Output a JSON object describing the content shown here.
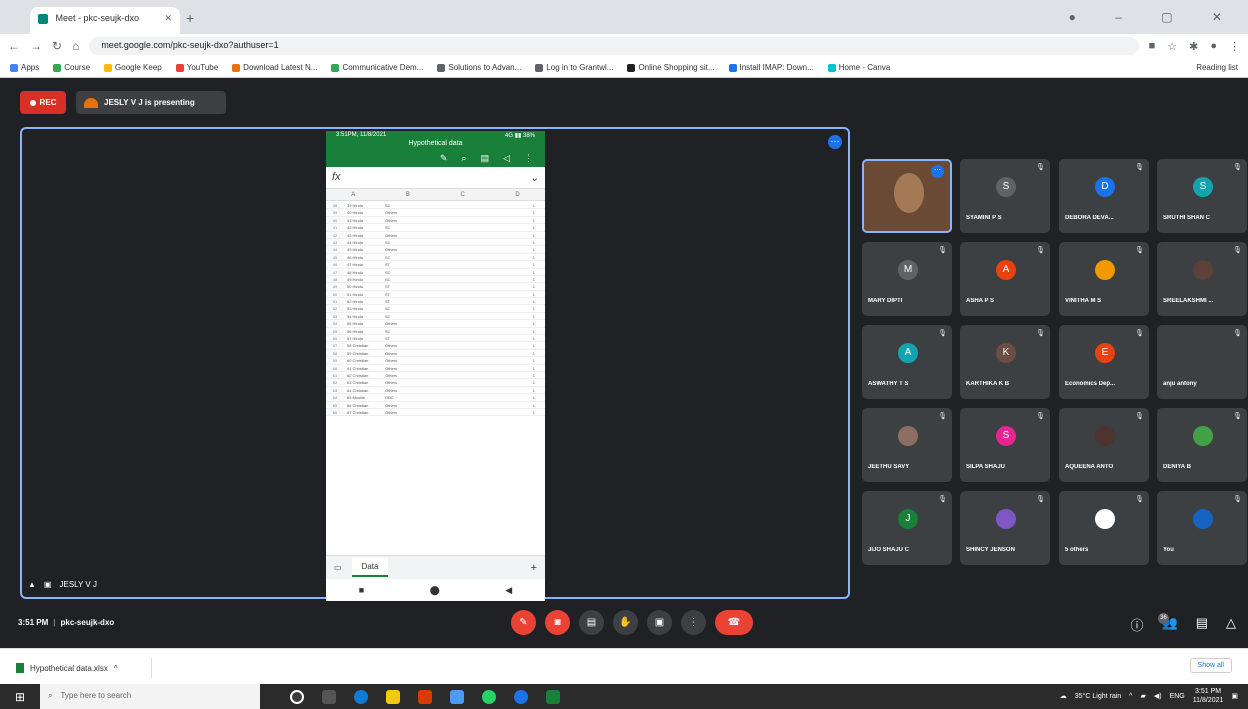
{
  "browser": {
    "tab_title": "Meet - pkc-seujk-dxo",
    "url": "meet.google.com/pkc-seujk-dxo?authuser=1",
    "bookmarks": [
      {
        "label": "Apps",
        "color": "#4285f4"
      },
      {
        "label": "Course",
        "color": "#34a853"
      },
      {
        "label": "Google Keep",
        "color": "#fbbc04"
      },
      {
        "label": "YouTube",
        "color": "#ea4335"
      },
      {
        "label": "Download Latest N...",
        "color": "#e8710a"
      },
      {
        "label": "Communicative Dem...",
        "color": "#34a853"
      },
      {
        "label": "Solutions to Advan...",
        "color": "#5f6368"
      },
      {
        "label": "Log in to Grantwl...",
        "color": "#5f6368"
      },
      {
        "label": "Online Shopping sit...",
        "color": "#202124"
      },
      {
        "label": "Install IMAP: Down...",
        "color": "#1a73e8"
      },
      {
        "label": "Home - Canva",
        "color": "#00c4cc"
      }
    ],
    "reading_list": "Reading list"
  },
  "meet": {
    "rec_label": "REC",
    "presenting_label": "JESLY V J is presenting",
    "presenter_tile_label": "JESLY V J",
    "meeting_time": "3:51 PM",
    "meeting_code": "pkc-seujk-dxo",
    "people_count": "36"
  },
  "phone": {
    "status_time": "3:51PM, 11/8/2021",
    "status_right": "4G ▮▮ 38%",
    "sheet_title": "Hypothetical data",
    "fx": "fx",
    "col_headers": [
      "A",
      "B",
      "C",
      "D"
    ],
    "rows": [
      {
        "n": "38",
        "a": "39 Hindu",
        "b": "SC",
        "c": "1"
      },
      {
        "n": "39",
        "a": "40 Hindu",
        "b": "Others",
        "c": "1"
      },
      {
        "n": "40",
        "a": "41 Hindu",
        "b": "Others",
        "c": "1"
      },
      {
        "n": "41",
        "a": "42 Hindu",
        "b": "SC",
        "c": "1"
      },
      {
        "n": "42",
        "a": "43 Hindu",
        "b": "Others",
        "c": "1"
      },
      {
        "n": "43",
        "a": "44 Hindu",
        "b": "SC",
        "c": "1"
      },
      {
        "n": "44",
        "a": "45 Hindu",
        "b": "Others",
        "c": "1"
      },
      {
        "n": "45",
        "a": "46 Hindu",
        "b": "SC",
        "c": "1"
      },
      {
        "n": "46",
        "a": "47 Hindu",
        "b": "ST",
        "c": "1"
      },
      {
        "n": "47",
        "a": "48 Hindu",
        "b": "SC",
        "c": "1"
      },
      {
        "n": "48",
        "a": "49 Hindu",
        "b": "SC",
        "c": "1"
      },
      {
        "n": "49",
        "a": "50 Hindu",
        "b": "ST",
        "c": "1"
      },
      {
        "n": "50",
        "a": "51 Hindu",
        "b": "ST",
        "c": "1"
      },
      {
        "n": "51",
        "a": "52 Hindu",
        "b": "ST",
        "c": "1"
      },
      {
        "n": "52",
        "a": "53 Hindu",
        "b": "SC",
        "c": "1"
      },
      {
        "n": "53",
        "a": "54 Hindu",
        "b": "SC",
        "c": "1"
      },
      {
        "n": "54",
        "a": "55 Hindu",
        "b": "Others",
        "c": "1"
      },
      {
        "n": "55",
        "a": "56 Hindu",
        "b": "SC",
        "c": "1"
      },
      {
        "n": "56",
        "a": "57 Hindu",
        "b": "ST",
        "c": "1"
      },
      {
        "n": "57",
        "a": "58 Christian",
        "b": "Others",
        "c": "1"
      },
      {
        "n": "58",
        "a": "59 Christian",
        "b": "Others",
        "c": "1"
      },
      {
        "n": "59",
        "a": "60 Christian",
        "b": "Others",
        "c": "1"
      },
      {
        "n": "60",
        "a": "61 Christian",
        "b": "Others",
        "c": "1"
      },
      {
        "n": "61",
        "a": "62 Christian",
        "b": "Others",
        "c": "1"
      },
      {
        "n": "62",
        "a": "63 Christian",
        "b": "Others",
        "c": "1"
      },
      {
        "n": "63",
        "a": "64 Christian",
        "b": "Others",
        "c": "1"
      },
      {
        "n": "64",
        "a": "65 Muslim",
        "b": "OBC",
        "c": "1"
      },
      {
        "n": "65",
        "a": "66 Christian",
        "b": "Others",
        "c": "1"
      },
      {
        "n": "66",
        "a": "67 Christian",
        "b": "Others",
        "c": "1"
      }
    ],
    "sheet_tab": "Data"
  },
  "participants": [
    {
      "name": "",
      "initial": "",
      "color": "",
      "photo": true
    },
    {
      "name": "SYAMINI P S",
      "initial": "S",
      "color": "#5f6368"
    },
    {
      "name": "DEBORA DEVA...",
      "initial": "D",
      "color": "#1a73e8"
    },
    {
      "name": "SRUTHI SHAN C",
      "initial": "S",
      "color": "#12a4af"
    },
    {
      "name": "MARY DIPTI",
      "initial": "M",
      "color": "#5f6368"
    },
    {
      "name": "ASHA P S",
      "initial": "A",
      "color": "#e8430e"
    },
    {
      "name": "VINITHA M S",
      "initial": "",
      "color": "#f29900",
      "photo_small": true
    },
    {
      "name": "SREELAKSHMI ...",
      "initial": "",
      "color": "#5d4037",
      "photo_small": true
    },
    {
      "name": "ASWATHY T S",
      "initial": "A",
      "color": "#12a4af"
    },
    {
      "name": "KARTHIKA K B",
      "initial": "K",
      "color": "#6d4c41"
    },
    {
      "name": "Economics Dep...",
      "initial": "E",
      "color": "#e8430e"
    },
    {
      "name": "anju antony",
      "initial": "",
      "color": "#3c4043",
      "photo_small": true
    },
    {
      "name": "JEETHU SAVY",
      "initial": "",
      "color": "#8d6e63",
      "photo_small": true
    },
    {
      "name": "SILPA SHAJU",
      "initial": "S",
      "color": "#e52592"
    },
    {
      "name": "AQUEENA ANTO",
      "initial": "",
      "color": "#4e342e",
      "photo_small": true
    },
    {
      "name": "DENIYA B",
      "initial": "",
      "color": "#43a047",
      "photo_small": true
    },
    {
      "name": "JIJO SHAJU C",
      "initial": "J",
      "color": "#188038"
    },
    {
      "name": "SHINCY JENSON",
      "initial": "",
      "color": "#7e57c2",
      "photo_small": true
    },
    {
      "name": "5 others",
      "initial": "",
      "color": "#ffffff",
      "photo_small": true
    },
    {
      "name": "You",
      "initial": "",
      "color": "#1565c0",
      "photo_small": true
    }
  ],
  "downloads": {
    "file": "Hypothetical data.xlsx",
    "show_all": "Show all"
  },
  "taskbar": {
    "search_placeholder": "Type here to search",
    "weather": "35°C Light rain",
    "lang": "ENG",
    "time": "3:51 PM",
    "date": "11/8/2021"
  }
}
